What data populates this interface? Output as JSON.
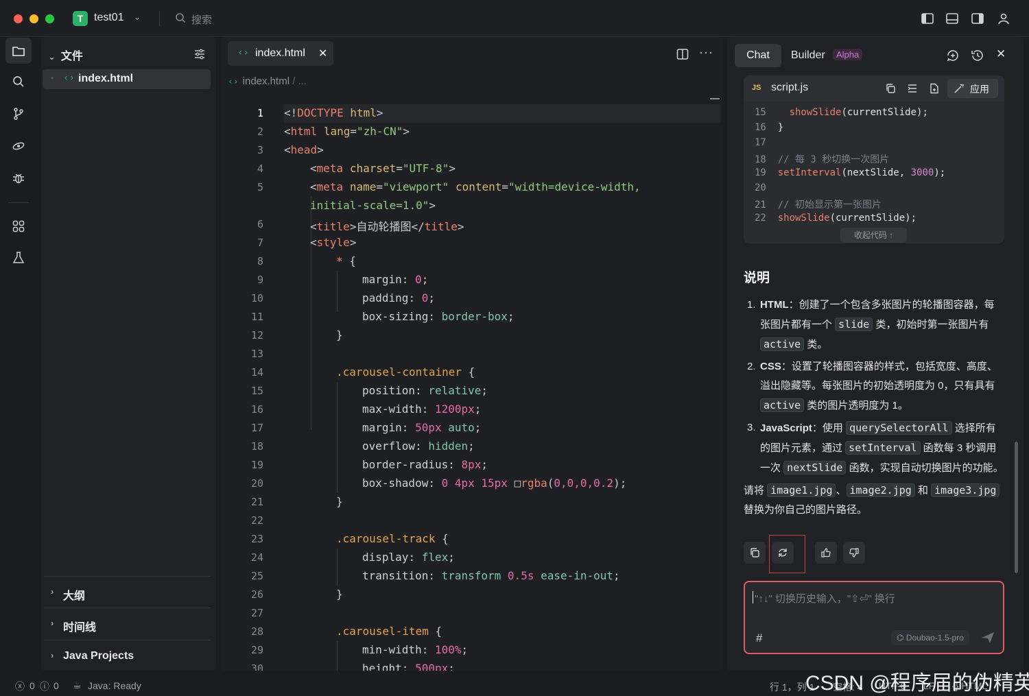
{
  "titlebar": {
    "project_initial": "T",
    "project_name": "test01",
    "search_placeholder": "搜索"
  },
  "explorer": {
    "header": "文件",
    "open_file": "index.html",
    "sections": [
      "大纲",
      "时间线",
      "Java Projects"
    ]
  },
  "editor": {
    "tab_label": "index.html",
    "breadcrumb": "index.html",
    "breadcrumb_more": "/ ...",
    "current_line": 1
  },
  "code_lines": [
    {
      "n": "1",
      "segs": [
        [
          "pun",
          "<!"
        ],
        [
          "tag",
          "DOCTYPE"
        ],
        [
          "pun",
          " "
        ],
        [
          "attr",
          "html"
        ],
        [
          "pun",
          ">"
        ]
      ],
      "indent": 0
    },
    {
      "n": "2",
      "segs": [
        [
          "pun",
          "<"
        ],
        [
          "tag",
          "html"
        ],
        [
          "pun",
          " "
        ],
        [
          "attr",
          "lang"
        ],
        [
          "pun",
          "="
        ],
        [
          "str",
          "\"zh-CN\""
        ],
        [
          "pun",
          ">"
        ]
      ],
      "indent": 0
    },
    {
      "n": "3",
      "segs": [
        [
          "pun",
          "<"
        ],
        [
          "tag",
          "head"
        ],
        [
          "pun",
          ">"
        ]
      ],
      "indent": 0
    },
    {
      "n": "4",
      "segs": [
        [
          "pun",
          "<"
        ],
        [
          "tag",
          "meta"
        ],
        [
          "pun",
          " "
        ],
        [
          "attr",
          "charset"
        ],
        [
          "pun",
          "="
        ],
        [
          "str",
          "\"UTF-8\""
        ],
        [
          "pun",
          ">"
        ]
      ],
      "indent": 1
    },
    {
      "n": "5",
      "segs": [
        [
          "pun",
          "<"
        ],
        [
          "tag",
          "meta"
        ],
        [
          "pun",
          " "
        ],
        [
          "attr",
          "name"
        ],
        [
          "pun",
          "="
        ],
        [
          "str",
          "\"viewport\""
        ],
        [
          "pun",
          " "
        ],
        [
          "attr",
          "content"
        ],
        [
          "pun",
          "="
        ],
        [
          "str",
          "\"width=device-width,"
        ]
      ],
      "indent": 1
    },
    {
      "n": "",
      "segs": [
        [
          "str",
          "initial-scale=1.0\""
        ],
        [
          "pun",
          ">"
        ]
      ],
      "indent": 1
    },
    {
      "n": "6",
      "segs": [
        [
          "pun",
          "<"
        ],
        [
          "tag",
          "title"
        ],
        [
          "pun",
          ">自动轮播图</"
        ],
        [
          "tag",
          "title"
        ],
        [
          "pun",
          ">"
        ]
      ],
      "indent": 1
    },
    {
      "n": "7",
      "segs": [
        [
          "pun",
          "<"
        ],
        [
          "tag",
          "style"
        ],
        [
          "pun",
          ">"
        ]
      ],
      "indent": 1
    },
    {
      "n": "8",
      "segs": [
        [
          "tag",
          "*"
        ],
        [
          "pun",
          " {"
        ]
      ],
      "indent": 2
    },
    {
      "n": "9",
      "segs": [
        [
          "prop",
          "margin"
        ],
        [
          "pun",
          ": "
        ],
        [
          "num",
          "0"
        ],
        [
          "pun",
          ";"
        ]
      ],
      "indent": 3
    },
    {
      "n": "10",
      "segs": [
        [
          "prop",
          "padding"
        ],
        [
          "pun",
          ": "
        ],
        [
          "num",
          "0"
        ],
        [
          "pun",
          ";"
        ]
      ],
      "indent": 3
    },
    {
      "n": "11",
      "segs": [
        [
          "prop",
          "box-sizing"
        ],
        [
          "pun",
          ": "
        ],
        [
          "kw",
          "border-box"
        ],
        [
          "pun",
          ";"
        ]
      ],
      "indent": 3
    },
    {
      "n": "12",
      "segs": [
        [
          "pun",
          "}"
        ]
      ],
      "indent": 2
    },
    {
      "n": "13",
      "segs": [],
      "indent": 0
    },
    {
      "n": "14",
      "segs": [
        [
          "sel",
          ".carousel-container"
        ],
        [
          "pun",
          " {"
        ]
      ],
      "indent": 2
    },
    {
      "n": "15",
      "segs": [
        [
          "prop",
          "position"
        ],
        [
          "pun",
          ": "
        ],
        [
          "kw",
          "relative"
        ],
        [
          "pun",
          ";"
        ]
      ],
      "indent": 3
    },
    {
      "n": "16",
      "segs": [
        [
          "prop",
          "max-width"
        ],
        [
          "pun",
          ": "
        ],
        [
          "num",
          "1200px"
        ],
        [
          "pun",
          ";"
        ]
      ],
      "indent": 3
    },
    {
      "n": "17",
      "segs": [
        [
          "prop",
          "margin"
        ],
        [
          "pun",
          ": "
        ],
        [
          "num",
          "50px"
        ],
        [
          "pun",
          " "
        ],
        [
          "kw",
          "auto"
        ],
        [
          "pun",
          ";"
        ]
      ],
      "indent": 3
    },
    {
      "n": "18",
      "segs": [
        [
          "prop",
          "overflow"
        ],
        [
          "pun",
          ": "
        ],
        [
          "kw",
          "hidden"
        ],
        [
          "pun",
          ";"
        ]
      ],
      "indent": 3
    },
    {
      "n": "19",
      "segs": [
        [
          "prop",
          "border-radius"
        ],
        [
          "pun",
          ": "
        ],
        [
          "num",
          "8px"
        ],
        [
          "pun",
          ";"
        ]
      ],
      "indent": 3
    },
    {
      "n": "20",
      "segs": [
        [
          "prop",
          "box-shadow"
        ],
        [
          "pun",
          ": "
        ],
        [
          "num",
          "0 4px 15px "
        ],
        [
          "pun",
          "□"
        ],
        [
          "tag",
          "rgba"
        ],
        [
          "pun",
          "("
        ],
        [
          "num",
          "0,0,0,0.2"
        ],
        [
          "pun",
          ");"
        ]
      ],
      "indent": 3
    },
    {
      "n": "21",
      "segs": [
        [
          "pun",
          "}"
        ]
      ],
      "indent": 2
    },
    {
      "n": "22",
      "segs": [],
      "indent": 0
    },
    {
      "n": "23",
      "segs": [
        [
          "sel",
          ".carousel-track"
        ],
        [
          "pun",
          " {"
        ]
      ],
      "indent": 2
    },
    {
      "n": "24",
      "segs": [
        [
          "prop",
          "display"
        ],
        [
          "pun",
          ": "
        ],
        [
          "kw",
          "flex"
        ],
        [
          "pun",
          ";"
        ]
      ],
      "indent": 3
    },
    {
      "n": "25",
      "segs": [
        [
          "prop",
          "transition"
        ],
        [
          "pun",
          ": "
        ],
        [
          "kw",
          "transform "
        ],
        [
          "num",
          "0.5s"
        ],
        [
          "kw",
          " ease-in-out"
        ],
        [
          "pun",
          ";"
        ]
      ],
      "indent": 3
    },
    {
      "n": "26",
      "segs": [
        [
          "pun",
          "}"
        ]
      ],
      "indent": 2
    },
    {
      "n": "27",
      "segs": [],
      "indent": 0
    },
    {
      "n": "28",
      "segs": [
        [
          "sel",
          ".carousel-item"
        ],
        [
          "pun",
          " {"
        ]
      ],
      "indent": 2
    },
    {
      "n": "29",
      "segs": [
        [
          "prop",
          "min-width"
        ],
        [
          "pun",
          ": "
        ],
        [
          "num",
          "100%"
        ],
        [
          "pun",
          ";"
        ]
      ],
      "indent": 3
    },
    {
      "n": "30",
      "segs": [
        [
          "prop",
          "height"
        ],
        [
          "pun",
          ": "
        ],
        [
          "num",
          "500px"
        ],
        [
          "pun",
          ";"
        ]
      ],
      "indent": 3
    }
  ],
  "chat": {
    "tab_chat": "Chat",
    "tab_builder": "Builder",
    "builder_badge": "Alpha",
    "code_file": "script.js",
    "code_lang_badge": "JS",
    "apply_label": "应用",
    "collapse_label": "收起代码 ↑",
    "snippet": [
      {
        "n": "15",
        "segs": [
          [
            "pun",
            "  "
          ],
          [
            "fn",
            "showSlide"
          ],
          [
            "pun",
            "(currentSlide);"
          ]
        ]
      },
      {
        "n": "16",
        "segs": [
          [
            "pun",
            "}"
          ]
        ]
      },
      {
        "n": "17",
        "segs": []
      },
      {
        "n": "18",
        "segs": [
          [
            "cm",
            "// 每 3 秒切换一次图片"
          ]
        ]
      },
      {
        "n": "19",
        "segs": [
          [
            "fn",
            "setInterval"
          ],
          [
            "pun",
            "(nextSlide, "
          ],
          [
            "nm",
            "3000"
          ],
          [
            "pun",
            ");"
          ]
        ]
      },
      {
        "n": "20",
        "segs": []
      },
      {
        "n": "21",
        "segs": [
          [
            "cm",
            "// 初始显示第一张图片"
          ]
        ]
      },
      {
        "n": "22",
        "segs": [
          [
            "fn",
            "showSlide"
          ],
          [
            "pun",
            "(currentSlide);"
          ]
        ]
      }
    ],
    "explain_title": "说明",
    "items": [
      {
        "num": "1.",
        "parts": [
          [
            "b",
            "HTML"
          ],
          [
            "t",
            "：创建了一个包含多张图片的轮播图容器，每张图片都有一个 "
          ],
          [
            "c",
            "slide"
          ],
          [
            "t",
            " 类，初始时第一张图片有 "
          ],
          [
            "c",
            "active"
          ],
          [
            "t",
            " 类。"
          ]
        ]
      },
      {
        "num": "2.",
        "parts": [
          [
            "b",
            "CSS"
          ],
          [
            "t",
            "：设置了轮播图容器的样式，包括宽度、高度、溢出隐藏等。每张图片的初始透明度为 0，只有具有 "
          ],
          [
            "c",
            "active"
          ],
          [
            "t",
            " 类的图片透明度为 1。"
          ]
        ]
      },
      {
        "num": "3.",
        "parts": [
          [
            "b",
            "JavaScript"
          ],
          [
            "t",
            "：使用 "
          ],
          [
            "c",
            "querySelectorAll"
          ],
          [
            "t",
            " 选择所有的图片元素，通过 "
          ],
          [
            "c",
            "setInterval"
          ],
          [
            "t",
            " 函数每 3 秒调用一次 "
          ],
          [
            "c",
            "nextSlide"
          ],
          [
            "t",
            " 函数，实现自动切换图片的功能。"
          ]
        ]
      }
    ],
    "note_parts": [
      [
        "t",
        "请将 "
      ],
      [
        "c",
        "image1.jpg"
      ],
      [
        "t",
        "、"
      ],
      [
        "c",
        "image2.jpg"
      ],
      [
        "t",
        " 和 "
      ],
      [
        "c",
        "image3.jpg"
      ],
      [
        "t",
        " 替换为你自己的图片路径。"
      ]
    ],
    "input_placeholder": "\"↑↓\" 切换历史输入，\"⇧⏎\" 换行",
    "hash": "#",
    "model": "Doubao-1.5-pro"
  },
  "status": {
    "errors": "0",
    "warnings": "0",
    "java_status": "Java: Ready",
    "cursor": "行 1，列 1",
    "spaces": "空格: 4",
    "encoding": "UTF-8",
    "eol": "LF",
    "language": "HTML"
  },
  "watermark": "CSDN @程序届的伪精英",
  "colors": {
    "accent_green": "#2fae68",
    "input_border": "#e05a6a",
    "tag": "#e8806b",
    "string": "#8fc97a"
  }
}
